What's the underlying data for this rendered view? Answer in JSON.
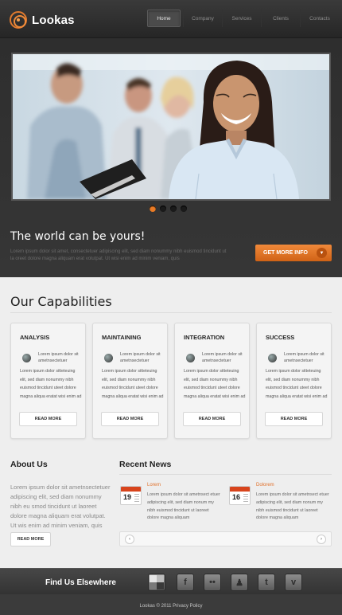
{
  "brand": {
    "name": "Lookas"
  },
  "nav": [
    {
      "label": "Home",
      "active": true
    },
    {
      "label": "Company",
      "active": false
    },
    {
      "label": "Services",
      "active": false
    },
    {
      "label": "Clients",
      "active": false
    },
    {
      "label": "Contacts",
      "active": false
    }
  ],
  "hero": {
    "slides_total": 4,
    "active_slide": 1,
    "tagline": "The world can be yours!",
    "text": "Lorem ipsum dolor sit amet, consectetuer adipiscing elit, sed diam nonummy nibh euismod tincidunt ut la oreet dolore magna aliquam erat volutpat. Ut wisi enim ad minim veniam, quis",
    "cta_label": "GET MORE INFO"
  },
  "capabilities": {
    "title": "Our Capabilities",
    "cards": [
      {
        "title": "ANALYSIS",
        "lead": "Lorem ipsum dolor sit ametnsectetuer",
        "body": "Lorem ipsum dolor sitteteuing elit, sed diam nonummy nibh euismod tincidunt uteet dolore magna aliqua eratat wisi enim ad",
        "button": "READ MORE"
      },
      {
        "title": "MAINTAINING",
        "lead": "Lorem ipsum dolor sit ametnsectetuer",
        "body": "Lorem ipsum dolor sitteteuing elit, sed diam nonummy nibh euismod tincidunt uteet dolore magna aliqua eratat wisi enim ad",
        "button": "READ MORE"
      },
      {
        "title": "INTEGRATION",
        "lead": "Lorem ipsum dolor sit ametnsectetuer",
        "body": "Lorem ipsum dolor sitteteuing elit, sed diam nonummy nibh euismod tincidunt uteet dolore magna aliqua eratat wisi enim ad",
        "button": "READ MORE"
      },
      {
        "title": "SUCCESS",
        "lead": "Lorem ipsum dolor sit ametnsectetuer",
        "body": "Lorem ipsum dolor sitteteuing elit, sed diam nonummy nibh euismod tincidunt uteet dolore magna aliqua eratat wisi enim ad",
        "button": "READ MORE"
      }
    ]
  },
  "about": {
    "title": "About Us",
    "text": "Lorem ipsum dolor sit ametnsectetuer adipiscing elit, sed diam nonummy nibh eu smod tincidunt ut laoreet dolore magna aliquam erat volutpat. Ut wis enim ad minim veniam, quis nostru",
    "button": "READ MORE"
  },
  "news": {
    "title": "Recent News",
    "items": [
      {
        "day": "19",
        "headline": "Lorem",
        "text": "Lorem ipsum dolor sit ametnsect etuer adipiscing elit, sed diam nonum my nibh euismod tincidunt ut laoreet dolore magna aliquam"
      },
      {
        "day": "16",
        "headline": "Dolorem",
        "text": "Lorem ipsum dolor sit ametnsect etuer adipiscing elit, sed diam nonum my nibh euismod tincidunt ut laoreet dolore magna aliquam"
      }
    ],
    "prev": "‹",
    "next": "›"
  },
  "footer": {
    "find_us": "Find Us Elsewhere",
    "social": [
      {
        "name": "delicious-icon",
        "glyph": ""
      },
      {
        "name": "facebook-icon",
        "glyph": "f"
      },
      {
        "name": "flickr-icon",
        "glyph": "••"
      },
      {
        "name": "myspace-icon",
        "glyph": "♟"
      },
      {
        "name": "twitter-icon",
        "glyph": "t"
      },
      {
        "name": "vimeo-icon",
        "glyph": "v"
      }
    ],
    "copyright": "Lookas © 2011 Privacy Policy"
  },
  "colors": {
    "accent": "#e97b26",
    "header_bg": "#2f2f2f",
    "page_bg": "#eeeeee"
  }
}
